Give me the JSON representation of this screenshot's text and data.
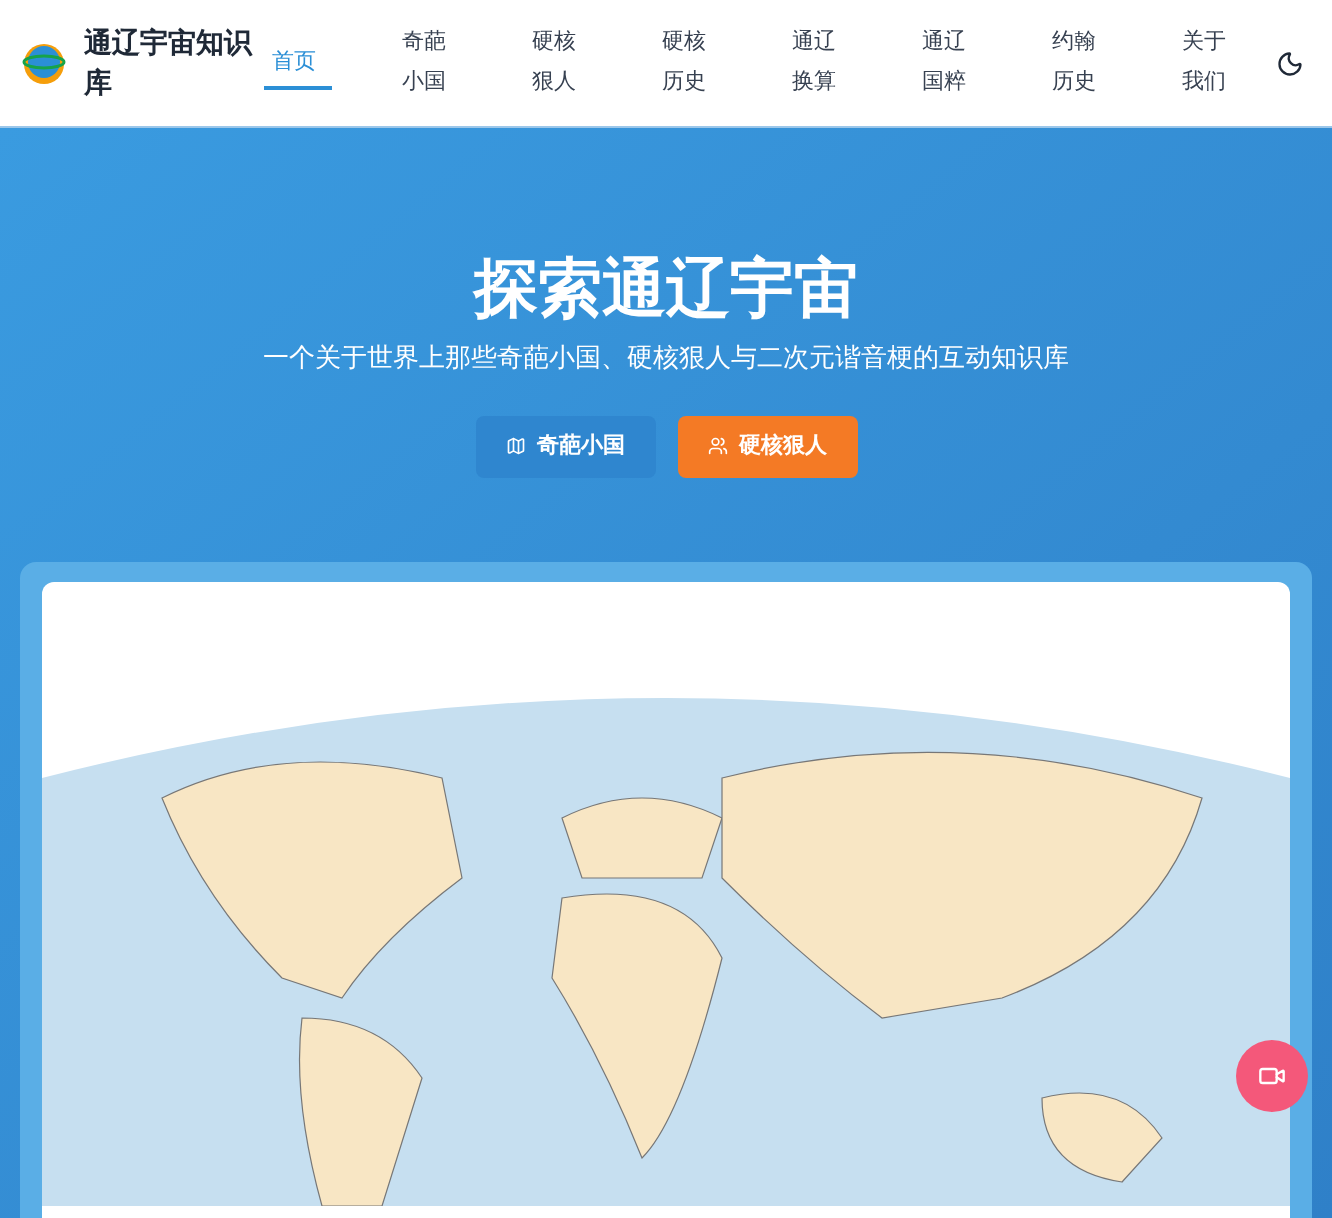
{
  "site_title": "通辽宇宙知识库",
  "nav": [
    {
      "label": "首页",
      "selected": true
    },
    {
      "label": "奇葩小国",
      "selected": false
    },
    {
      "label": "硬核狠人",
      "selected": false
    },
    {
      "label": "硬核历史",
      "selected": false
    },
    {
      "label": "通辽换算",
      "selected": false
    },
    {
      "label": "通辽国粹",
      "selected": false
    },
    {
      "label": "约翰历史",
      "selected": false
    },
    {
      "label": "关于我们",
      "selected": false
    }
  ],
  "hero": {
    "title": "探索通辽宇宙",
    "subtitle": "一个关于世界上那些奇葩小国、硬核狠人与二次元谐音梗的互动知识库",
    "buttons": [
      {
        "label": "奇葩小国",
        "kind": "secondary"
      },
      {
        "label": "硬核狠人",
        "kind": "primary"
      }
    ]
  }
}
